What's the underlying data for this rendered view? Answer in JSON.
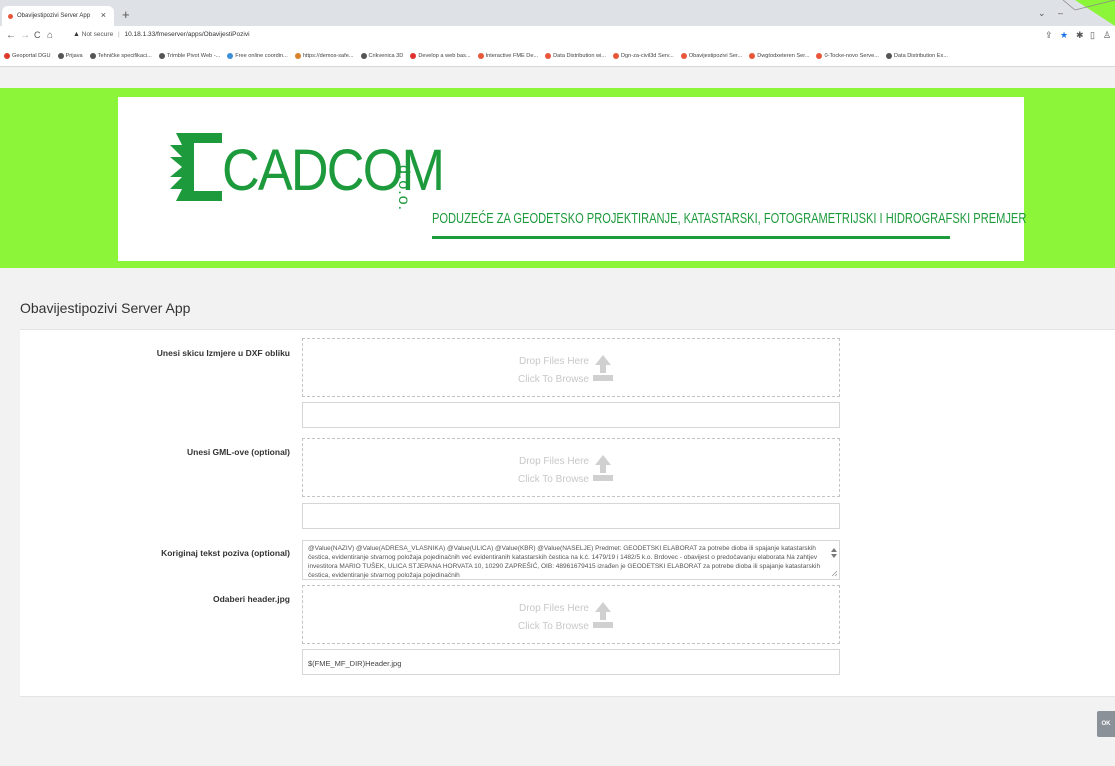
{
  "browser": {
    "tab_title": "Obavijestipozivi Server App",
    "tab_close": "×",
    "new_tab": "+",
    "window_controls": [
      "⌄",
      "–",
      "▢"
    ],
    "nav_back": "←",
    "nav_forward": "→",
    "nav_reload": "C",
    "nav_home": "⌂",
    "security_label": "Not secure",
    "url": "10.18.1.33/fmeserver/apps/ObavijestiPozivi",
    "bookmarks": [
      {
        "label": "Geoportal DGU",
        "color": "#e0392b"
      },
      {
        "label": "Prijava",
        "color": "#555"
      },
      {
        "label": "Tehničke specifikaci...",
        "color": "#555"
      },
      {
        "label": "Trimble Pivot Web -...",
        "color": "#555"
      },
      {
        "label": "Free online coordin...",
        "color": "#3b8fd8"
      },
      {
        "label": "https://demos-safe...",
        "color": "#d9822b"
      },
      {
        "label": "Crikvenica 3D",
        "color": "#555"
      },
      {
        "label": "Develop a web bas...",
        "color": "#e03030"
      },
      {
        "label": "Interactive FME De...",
        "color": "#e8573a"
      },
      {
        "label": "Data Distribution wi...",
        "color": "#e8573a"
      },
      {
        "label": "Dgn-za-civil3d Serv...",
        "color": "#e8573a"
      },
      {
        "label": "Obavijestipozivi Ser...",
        "color": "#e8573a"
      },
      {
        "label": "Dwgtodxeteren Ser...",
        "color": "#e8573a"
      },
      {
        "label": "0-Tocke-novo Serve...",
        "color": "#e8573a"
      },
      {
        "label": "Data Distribution Ex...",
        "color": "#555"
      }
    ]
  },
  "header": {
    "logo_text": "CADCOM",
    "logo_suffix": "d.o.o.",
    "tagline": "PODUZEĆE ZA GEODETSKO PROJEKTIRANJE, KATASTARSKI, FOTOGRAMETRIJSKI I HIDROGRAFSKI PREMJER",
    "brand_color": "#1d9a3c",
    "band_color": "#8cf53a"
  },
  "app": {
    "title": "Obavijestipozivi Server App",
    "drop_text": "Drop Files Here",
    "browse_text": "Click To Browse",
    "fields": {
      "dxf_label": "Unesi skicu Izmjere u DXF obliku",
      "dxf_value": "",
      "gml_label": "Unesi GML-ove (optional)",
      "gml_value": "",
      "text_label": "Koriginaj tekst poziva (optional)",
      "text_value": "@Value(NAZIV) @Value(ADRESA_VLASNIKA) @Value(ULICA) @Value(KBR) @Value(NASELJE)  Predmet: GEODETSKI ELABORAT za potrebe dioba ili spajanje katastarskih čestica, evidentiranje stvarnog položaja pojedinačnih već evidentiranih katastarskih čestica na k.č. 1479/19 i 1482/5 k.o. Brdovec - obavijest o predočavanju elaborata   Na zahtjev investitora MARIO TUŠEK, ULICA STJEPANA HORVATA 10, 10290 ZAPREŠIĆ, OIB: 48961679415 izrađen je GEODETSKI ELABORAT za potrebe dioba ili spajanje katastarskih čestica, evidentiranje stvarnog položaja pojedinačnih",
      "header_label": "Odaberi header.jpg",
      "header_value": "$(FME_MF_DIR)Header.jpg"
    },
    "ok_label": "OK"
  }
}
